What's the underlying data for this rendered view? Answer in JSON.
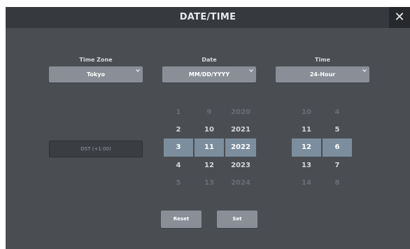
{
  "window": {
    "title": "DATE/TIME",
    "close_glyph": "✕"
  },
  "time_zone": {
    "label": "Time Zone",
    "value": "Tokyo"
  },
  "date": {
    "label": "Date",
    "value": "MM/DD/YYYY"
  },
  "time": {
    "label": "Time",
    "value": "24-Hour"
  },
  "dst": {
    "label": "DST (+1:00)"
  },
  "pickers": {
    "month": [
      "1",
      "2",
      "3",
      "4",
      "5"
    ],
    "day": [
      "9",
      "10",
      "11",
      "12",
      "13"
    ],
    "year": [
      "2020",
      "2021",
      "2022",
      "2023",
      "2024"
    ],
    "hour": [
      "10",
      "11",
      "12",
      "13",
      "14"
    ],
    "minute": [
      "4",
      "5",
      "6",
      "7",
      "8"
    ]
  },
  "buttons": {
    "reset": "Reset",
    "set": "Set"
  },
  "colors": {
    "selected_bg": "#7c8e9d",
    "window_bg": "#4a4d52",
    "titlebar_bg": "#36393d"
  }
}
